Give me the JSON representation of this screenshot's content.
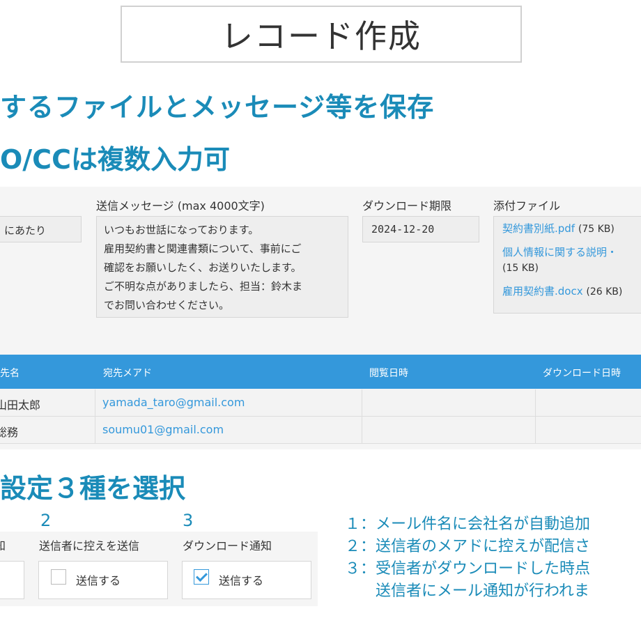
{
  "title": "レコード作成",
  "heading1": "するファイルとメッセージ等を保存",
  "heading2": "O/CCは複数入力可",
  "heading3": "設定３種を選択",
  "fields": {
    "message_label": "送信メッセージ (max 4000文字)",
    "deadline_label": "ダウンロード期限",
    "attachments_label": "添付ファイル"
  },
  "subject_value": "にあたり",
  "message_lines": [
    "いつもお世話になっております。",
    "雇用契約書と関連書類について、事前にご",
    "確認をお願いしたく、お送りいたします。",
    "ご不明な点がありましたら、担当：鈴木ま",
    "でお問い合わせください。"
  ],
  "deadline_value": "2024-12-20",
  "attachments": [
    {
      "name": "契約書別紙.pdf",
      "size": "(75 KB)"
    },
    {
      "name": "個人情報に関する説明・",
      "size": "(15 KB)"
    },
    {
      "name": "雇用契約書.docx",
      "size": "(26 KB)"
    }
  ],
  "table": {
    "headers": [
      "宛先名",
      "宛先メアド",
      "閲覧日時",
      "ダウンロード日時"
    ],
    "rows": [
      {
        "name": "山田太郎",
        "email": "yamada_taro@gmail.com",
        "viewed": "",
        "downloaded": ""
      },
      {
        "name": "総務",
        "email": "soumu01@gmail.com",
        "viewed": "",
        "downloaded": ""
      }
    ]
  },
  "settings": {
    "numbers": [
      "2",
      "3"
    ],
    "col1_label": "知",
    "col2_label": "送信者に控えを送信",
    "col3_label": "ダウンロード通知",
    "col2_option": "送信する",
    "col2_checked": false,
    "col3_option": "送信する",
    "col3_checked": true
  },
  "notes": [
    "１：メール件名に会社名が自動追加",
    "２：送信者のメアドに控えが配信さ",
    "３：受信者がダウンロードした時点",
    "　　送信者にメール通知が行われま"
  ],
  "colors": {
    "accent": "#1a8bb8",
    "header_blue": "#3498db",
    "link": "#3498db"
  }
}
